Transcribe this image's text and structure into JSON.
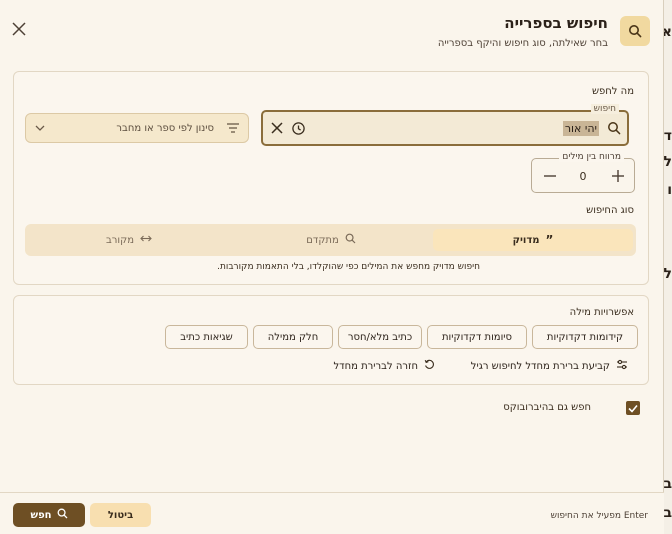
{
  "dialog": {
    "title": "חיפוש בספרייה",
    "subtitle": "בחר שאילתה, סוג חיפוש והיקף בספרייה"
  },
  "query": {
    "section_label": "מה לחפש",
    "field_label": "חיפוש",
    "value": "יהי אור",
    "filter_placeholder": "סינון לפי ספר או מחבר"
  },
  "distance": {
    "label": "מרווח בין מילים",
    "value": "0"
  },
  "search_type": {
    "label": "סוג החיפוש",
    "tabs": [
      {
        "label": "מדויק",
        "icon": "quote-icon",
        "active": true
      },
      {
        "label": "מתקדם",
        "icon": "zoom-icon",
        "active": false
      },
      {
        "label": "מקורב",
        "icon": "arrows-icon",
        "active": false
      }
    ],
    "description": "חיפוש מדויק מחפש את המילים כפי שהוקלדו, בלי התאמות מקורבות."
  },
  "word_options": {
    "label": "אפשרויות מילה",
    "chips": [
      "קידומות דקדוקיות",
      "סיומות דקדוקיות",
      "כתיב מלא/חסר",
      "חלק ממילה",
      "שגיאות כתיב"
    ],
    "set_default": "קביעת ברירת מחדל לחיפוש רגיל",
    "reset_default": "חזרה לברירת מחדל"
  },
  "hebrewbooks": {
    "label": "חפש גם בהיברובוקס",
    "checked": true
  },
  "footer": {
    "hint": "Enter מפעיל את החיפוש",
    "search_button": "חפש",
    "cancel_button": "ביטול"
  },
  "colors": {
    "accent": "#6e4f24",
    "active_tab": "#fae5bb",
    "background": "#faf5ec"
  }
}
